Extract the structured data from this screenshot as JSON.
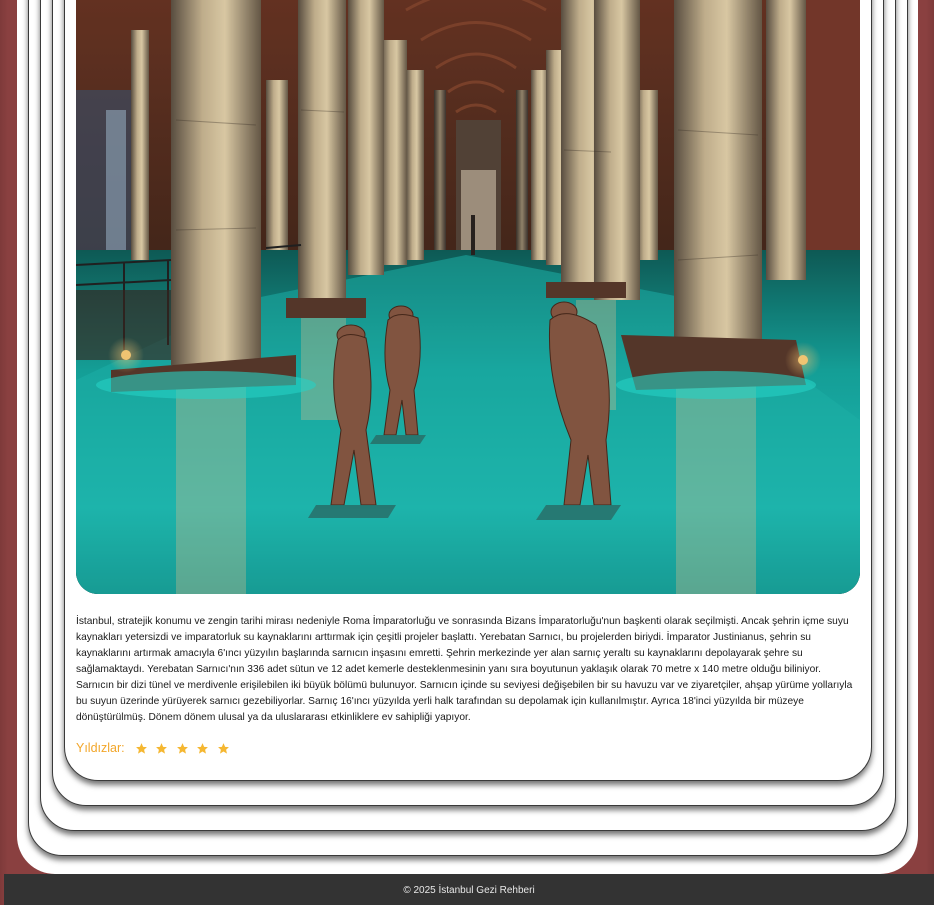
{
  "image": {
    "alt": "",
    "icon": "photo-basilica-cistern"
  },
  "description": "İstanbul, stratejik konumu ve zengin tarihi mirası nedeniyle Roma İmparatorluğu ve sonrasında Bizans İmparatorluğu'nun başkenti olarak seçilmişti. Ancak şehrin içme suyu kaynakları yetersizdi ve imparatorluk su kaynaklarını arttırmak için çeşitli projeler başlattı. Yerebatan Sarnıcı, bu projelerden biriydi. İmparator Justinianus, şehrin su kaynaklarını artırmak amacıyla 6'ıncı yüzyılın başlarında sarnıcın inşasını emretti. Şehrin merkezinde yer alan sarnıç yeraltı su kaynaklarını depolayarak şehre su sağlamaktaydı. Yerebatan Sarnıcı'nın 336 adet sütun ve 12 adet kemerle desteklenmesinin yanı sıra boyutunun yaklaşık olarak 70 metre x 140 metre olduğu biliniyor. Sarnıcın bir dizi tünel ve merdivenle erişilebilen iki büyük bölümü bulunuyor. Sarnıcın içinde su seviyesi değişebilen bir su havuzu var ve ziyaretçiler, ahşap yürüme yollarıyla bu suyun üzerinde yürüyerek sarnıcı gezebiliyorlar. Sarnıç 16'ıncı yüzyılda yerli halk tarafından su depolamak için kullanılmıştır. Ayrıca 18'inci yüzyılda bir müzeye dönüştürülmüş. Dönem dönem ulusal ya da uluslararası etkinliklere ev sahipliği yapıyor.",
  "rating": {
    "label": "Yıldızlar:",
    "stars": 5,
    "max": 5,
    "icon": "star-icon",
    "color": "#f5b731"
  },
  "footer": {
    "text": "© 2025 İstanbul Gezi Rehberi"
  },
  "colors": {
    "background": "#8a4040",
    "card": "#ffffff",
    "footer": "#333333",
    "accent": "#f2a62a"
  }
}
